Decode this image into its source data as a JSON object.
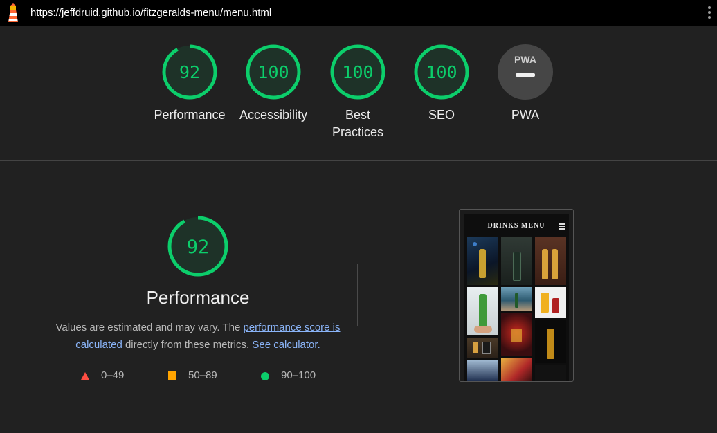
{
  "topbar": {
    "url": "https://jeffdruid.github.io/fitzgeralds-menu/menu.html",
    "logo_icon": "lighthouse-icon",
    "menu_icon": "kebab-menu-icon"
  },
  "colors": {
    "pass": "#0cce6b",
    "average": "#ffa400",
    "fail": "#ff4e42",
    "na": "#9e9e9e",
    "link": "#8ab4f8"
  },
  "gauges": [
    {
      "label": "Performance",
      "score": 92
    },
    {
      "label": "Accessibility",
      "score": 100
    },
    {
      "label": "Best Practices",
      "score": 100
    },
    {
      "label": "SEO",
      "score": 100
    },
    {
      "label": "PWA",
      "badge": "PWA",
      "score": null
    }
  ],
  "performance": {
    "score": 92,
    "title": "Performance",
    "desc_prefix": "Values are estimated and may vary. The ",
    "score_link": "performance score is calculated",
    "desc_middle": " directly from these metrics. ",
    "calc_link": "See calculator."
  },
  "legend": [
    {
      "range": "0–49",
      "shape": "triangle"
    },
    {
      "range": "50–89",
      "shape": "square"
    },
    {
      "range": "90–100",
      "shape": "circle"
    }
  ],
  "screenshot": {
    "title": "DRINKS MENU"
  }
}
